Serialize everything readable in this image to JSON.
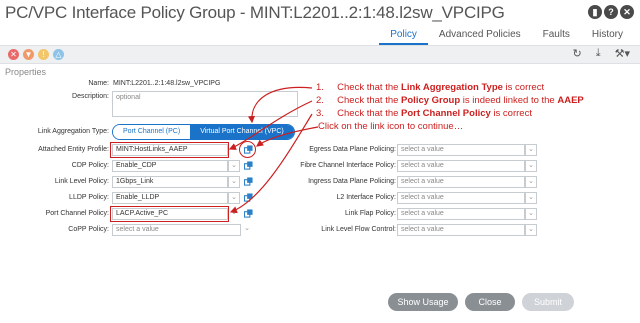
{
  "title": "PC/VPC Interface Policy Group - MINT:L2201..2:1:48.l2sw_VPCIPG",
  "tabs": [
    "Policy",
    "Advanced Policies",
    "Faults",
    "History"
  ],
  "section": "Properties",
  "form": {
    "name_label": "Name:",
    "name_value": "MINT:L2201..2:1:48.l2sw_VPCIPG",
    "description_label": "Description:",
    "description_placeholder": "optional",
    "lag_label": "Link Aggregation Type:",
    "lag_options": [
      "Port Channel (PC)",
      "Virtual Port Channel (VPC)"
    ],
    "lag_selected": "Virtual Port Channel (VPC)",
    "left_fields": [
      {
        "label": "Attached Entity Profile:",
        "value": "MINT:HostLinks_AAEP"
      },
      {
        "label": "CDP Policy:",
        "value": "Enable_CDP"
      },
      {
        "label": "Link Level Policy:",
        "value": "1Gbps_Link"
      },
      {
        "label": "LLDP Policy:",
        "value": "Enable_LLDP"
      },
      {
        "label": "Port Channel Policy:",
        "value": "LACP.Active_PC"
      },
      {
        "label": "CoPP Policy:",
        "value": "select a value"
      }
    ],
    "right_fields": [
      {
        "label": "Egress Data Plane Policing:",
        "value": "select a value"
      },
      {
        "label": "Fibre Channel Interface Policy:",
        "value": "select a value"
      },
      {
        "label": "Ingress Data Plane Policing:",
        "value": "select a value"
      },
      {
        "label": "L2 Interface Policy:",
        "value": "select a value"
      },
      {
        "label": "Link Flap Policy:",
        "value": "select a value"
      },
      {
        "label": "Link Level Flow Control:",
        "value": "select a value"
      }
    ]
  },
  "annotations": {
    "a1_num": "1.",
    "a1_pre": "Check that the ",
    "a1_bold": "Link Aggregation Type",
    "a1_post": " is correct",
    "a2_num": "2.",
    "a2_pre": "Check that the ",
    "a2_bold": "Policy Group",
    "a2_mid": " is indeed linked to the ",
    "a2_bold2": "AAEP",
    "a3_num": "3.",
    "a3_pre": "Check that the ",
    "a3_bold": "Port Channel Policy",
    "a3_post": " is correct",
    "a4": "Click on the link icon to continue…"
  },
  "buttons": {
    "show_usage": "Show Usage",
    "close": "Close",
    "submit": "Submit"
  },
  "colors": {
    "accent": "#1b73c9",
    "annotation": "#cc1f1f",
    "button_gray": "#8a8f94",
    "submit_disabled": "#cfd3d7"
  },
  "icons": [
    "bookmark-icon",
    "help-icon",
    "close-icon",
    "refresh-icon",
    "download-icon",
    "tools-icon",
    "link-icon"
  ]
}
